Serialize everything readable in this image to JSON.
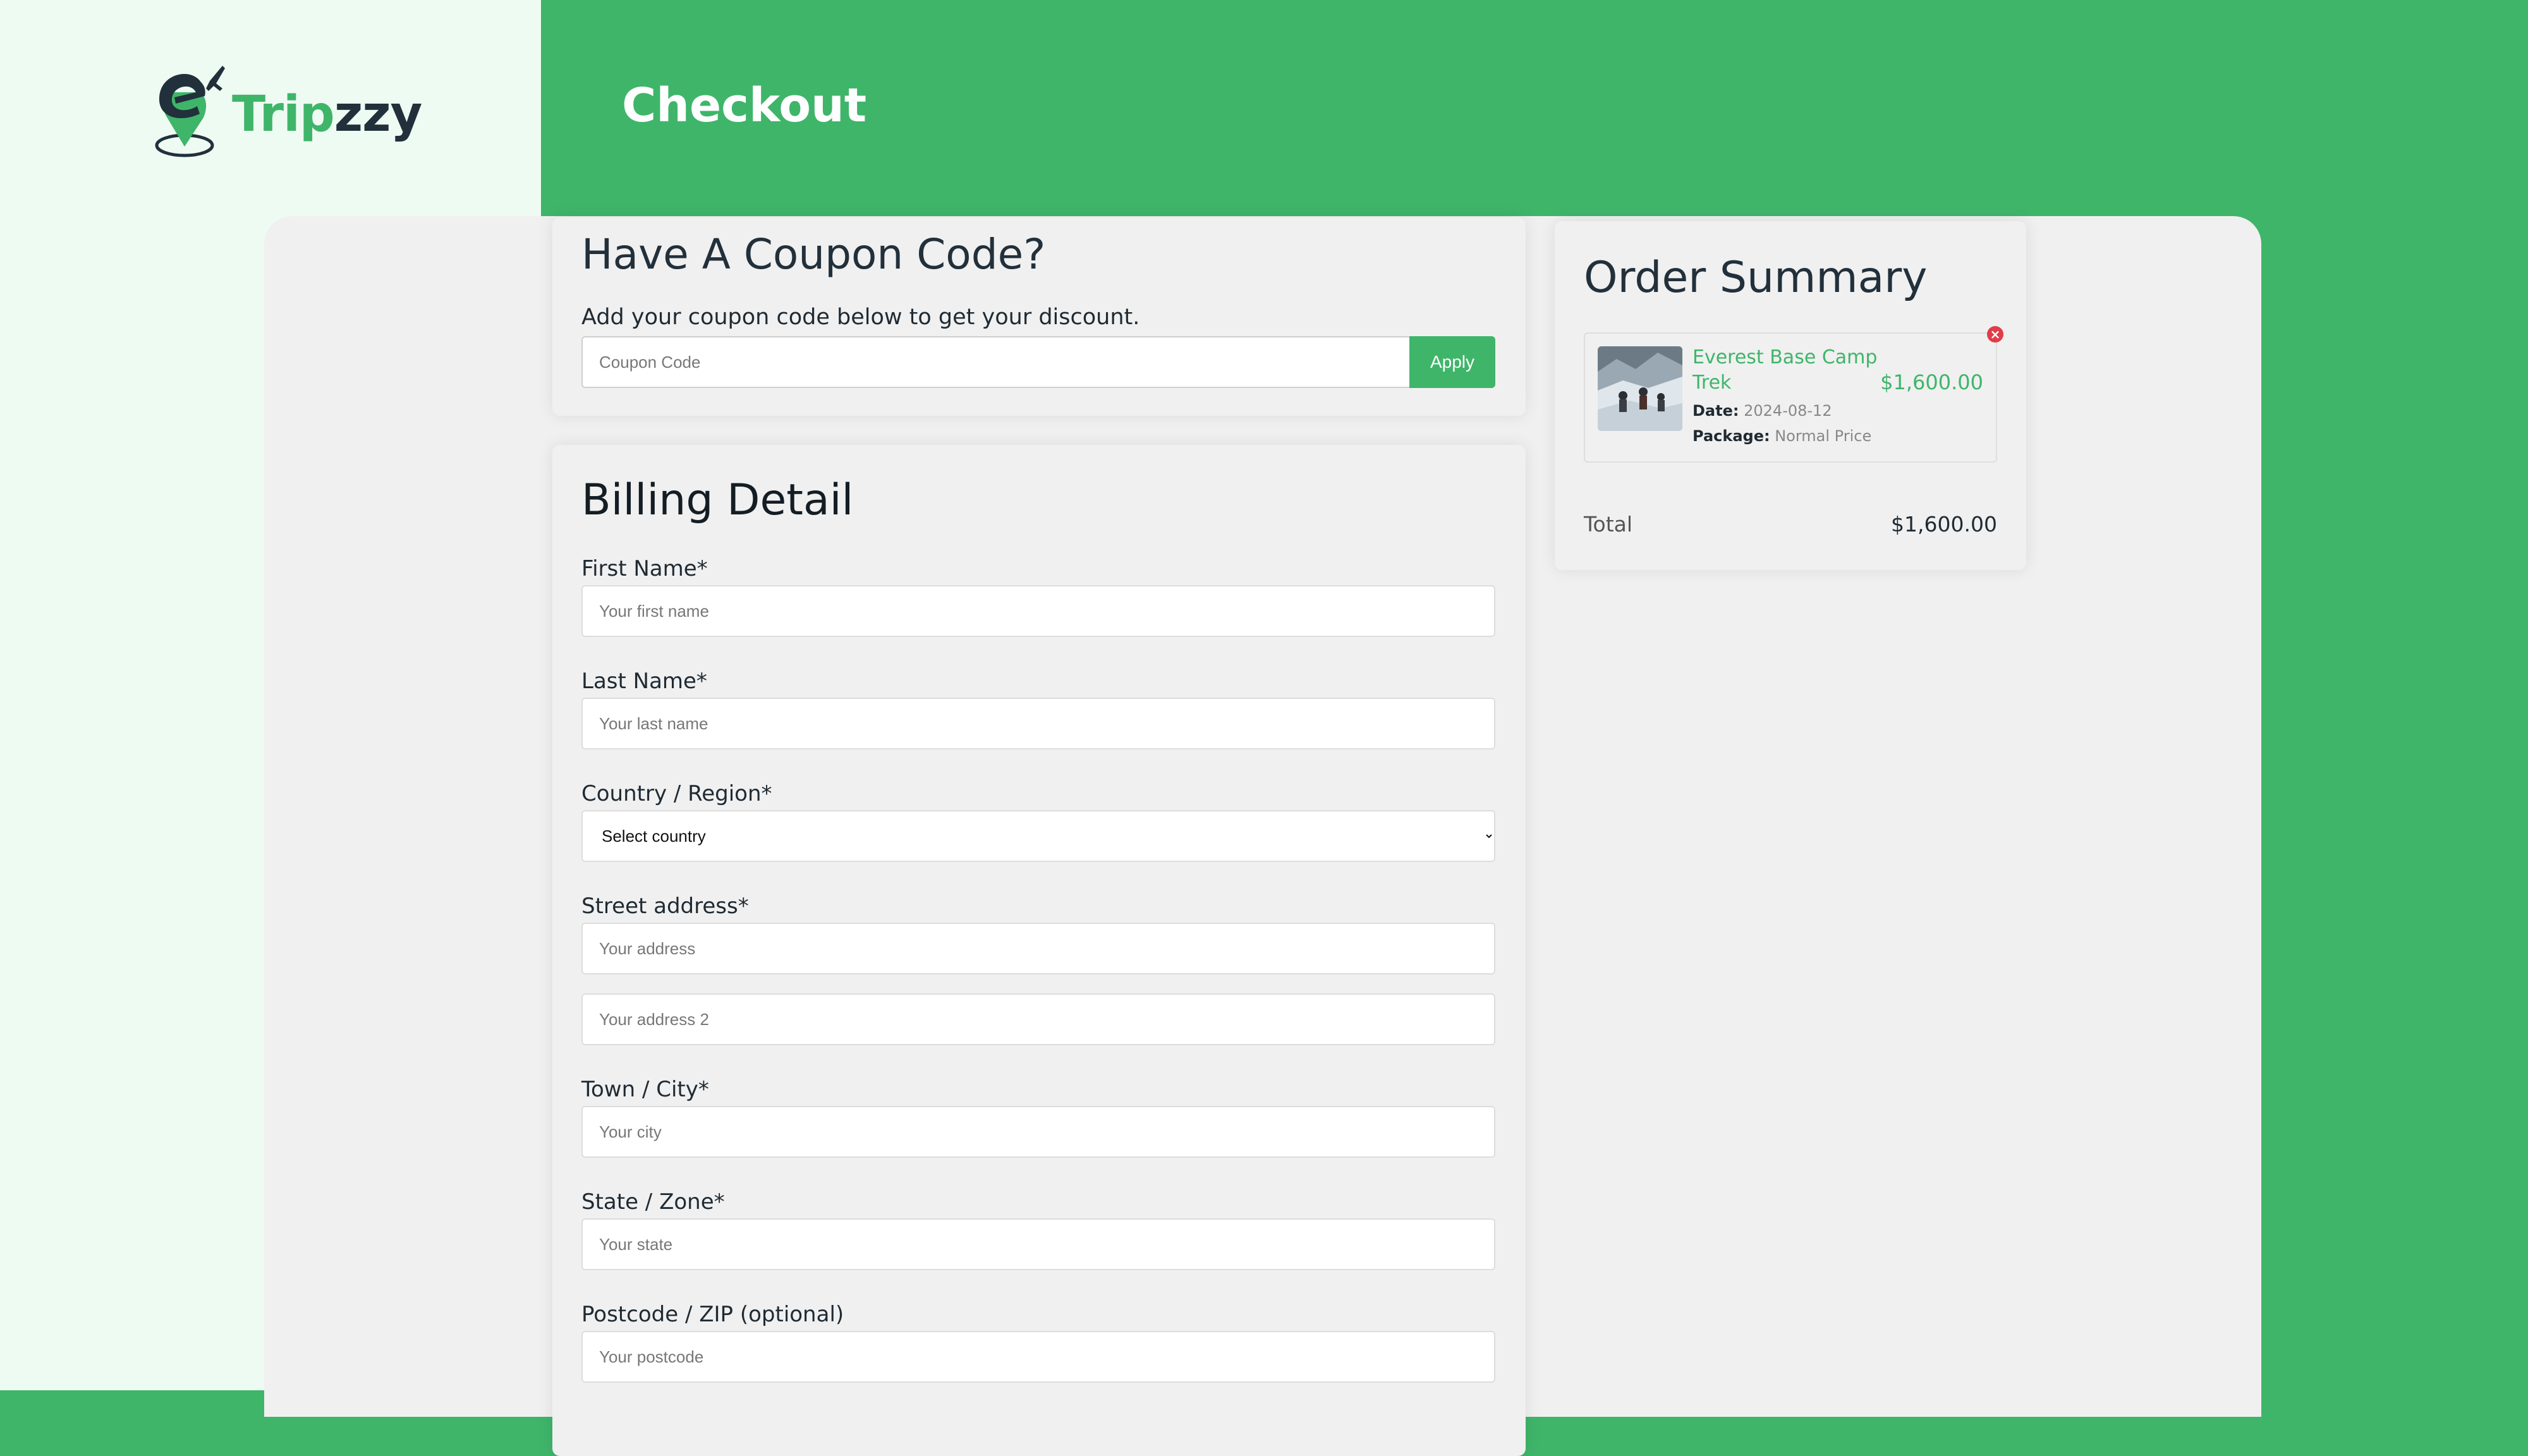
{
  "brand": {
    "name_part1": "Trip",
    "name_part2": "zzy",
    "accent_color": "#3fb56a",
    "dark_color": "#22303b",
    "icon": "map-pin-plane-icon"
  },
  "header": {
    "title": "Checkout"
  },
  "coupon": {
    "title": "Have A Coupon Code?",
    "description": "Add your coupon code below to get your discount.",
    "placeholder": "Coupon Code",
    "apply_label": "Apply"
  },
  "billing": {
    "title": "Billing Detail",
    "first_name_label": "First Name*",
    "first_name_placeholder": "Your first name",
    "last_name_label": "Last Name*",
    "last_name_placeholder": "Your last name",
    "country_label": "Country / Region*",
    "country_selected": "Select country",
    "street_label": "Street address*",
    "address_placeholder": "Your address",
    "address2_placeholder": "Your address 2",
    "city_label": "Town / City*",
    "city_placeholder": "Your city",
    "state_label": "State / Zone*",
    "state_placeholder": "Your state",
    "postcode_label": "Postcode / ZIP (optional)",
    "postcode_placeholder": "Your postcode"
  },
  "summary": {
    "title": "Order Summary",
    "item": {
      "name": "Everest Base Camp Trek",
      "price": "$1,600.00",
      "date_label": "Date:",
      "date_value": "2024-08-12",
      "package_label": "Package:",
      "package_value": "Normal Price",
      "remove_icon": "close-circle-icon"
    },
    "total_label": "Total",
    "total_value": "$1,600.00"
  }
}
